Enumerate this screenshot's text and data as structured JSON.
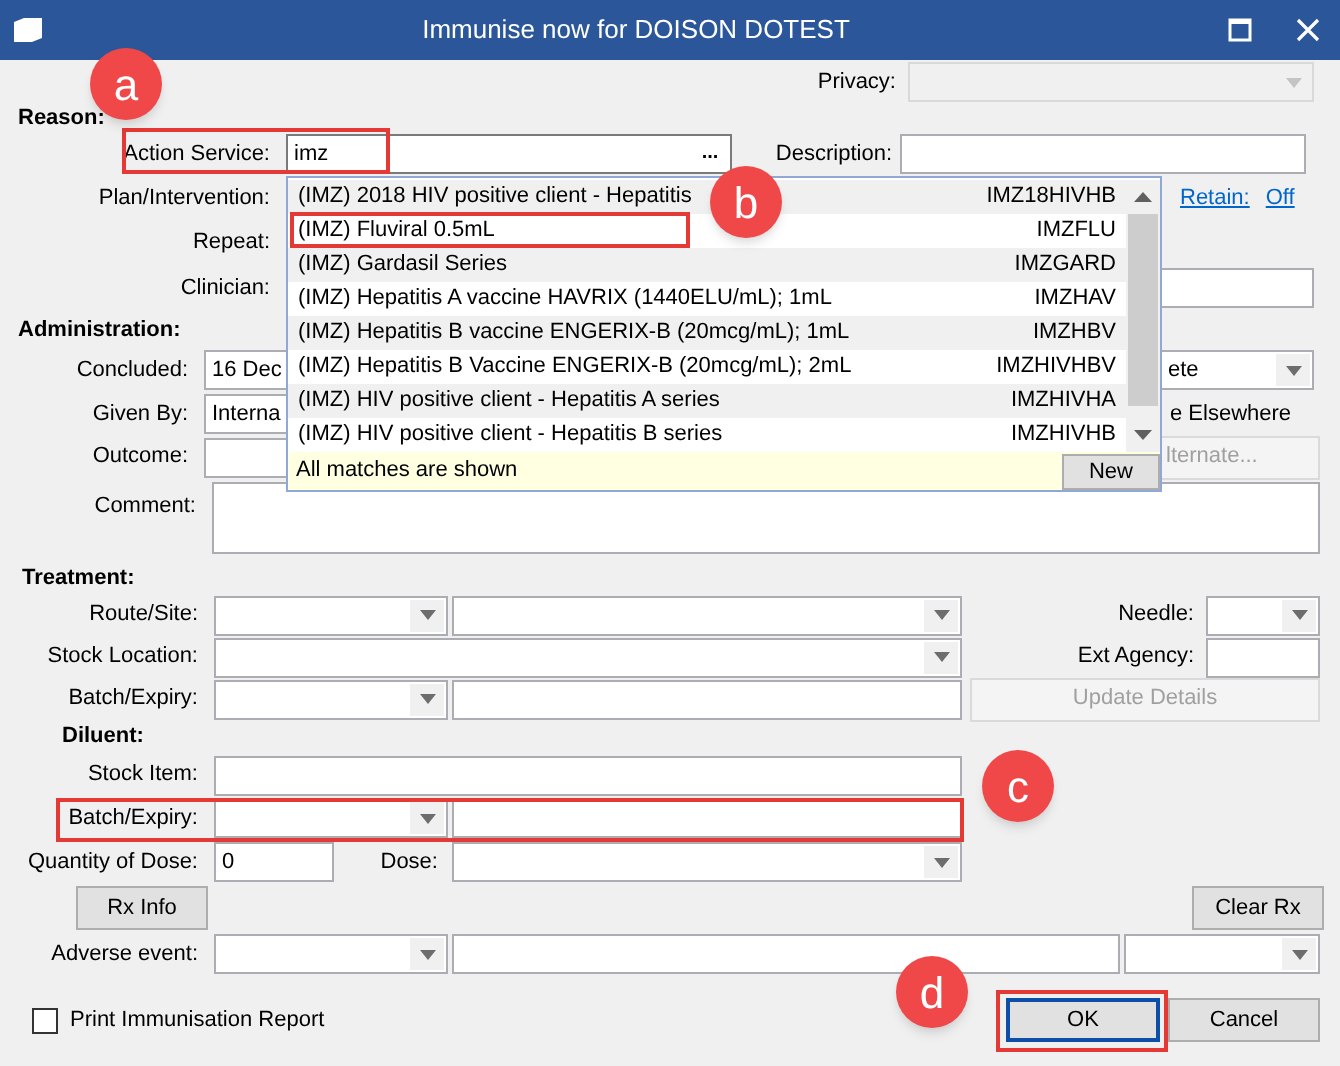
{
  "window": {
    "title": "Immunise now for DOISON DOTEST"
  },
  "privacy": {
    "label": "Privacy:",
    "disabled": true
  },
  "reason": {
    "heading": "Reason:",
    "action_service": {
      "label": "Action Service:",
      "value": "imz",
      "button": "..."
    },
    "description_label": "Description:",
    "plan_label": "Plan/Intervention:",
    "retain": {
      "label": "Retain:",
      "value": "Off"
    },
    "repeat_label": "Repeat:",
    "clinician_label": "Clinician:"
  },
  "administration": {
    "heading": "Administration:",
    "concluded": {
      "label": "Concluded:",
      "value": "16 Dec",
      "right_value": "ete"
    },
    "given_by": {
      "label": "Given By:",
      "value": "Interna",
      "right_text": "e Elsewhere"
    },
    "outcome": {
      "label": "Outcome:",
      "button": "lternate...",
      "button_disabled": true
    },
    "comment_label": "Comment:"
  },
  "treatment": {
    "heading": "Treatment:",
    "route_label": "Route/Site:",
    "needle_label": "Needle:",
    "stock_location_label": "Stock Location:",
    "ext_agency_label": "Ext Agency:",
    "batch_label": "Batch/Expiry:",
    "update_button": {
      "label": "Update Details",
      "disabled": true
    }
  },
  "diluent": {
    "heading": "Diluent:",
    "stock_item_label": "Stock Item:",
    "batch_label": "Batch/Expiry:",
    "quantity": {
      "label": "Quantity of Dose:",
      "value": "0"
    },
    "dose_label": "Dose:"
  },
  "rx_info_button": "Rx Info",
  "clear_rx_button": "Clear Rx",
  "adverse_event_label": "Adverse event:",
  "print_report": {
    "label": "Print Immunisation Report",
    "checked": false
  },
  "ok_button": {
    "label": "OK",
    "focused": true
  },
  "cancel_button": "Cancel",
  "dropdown": {
    "items": [
      {
        "name": "(IMZ) 2018 HIV positive client - Hepatitis",
        "code": "IMZ18HIVHB"
      },
      {
        "name": "(IMZ) Fluviral 0.5mL",
        "code": "IMZFLU"
      },
      {
        "name": "(IMZ) Gardasil Series",
        "code": "IMZGARD"
      },
      {
        "name": "(IMZ) Hepatitis A vaccine HAVRIX (1440ELU/mL); 1mL",
        "code": "IMZHAV"
      },
      {
        "name": "(IMZ) Hepatitis B vaccine ENGERIX-B (20mcg/mL); 1mL",
        "code": "IMZHBV"
      },
      {
        "name": "(IMZ) Hepatitis B Vaccine ENGERIX-B (20mcg/mL); 2mL",
        "code": "IMZHIVHBV"
      },
      {
        "name": "(IMZ) HIV positive client - Hepatitis A series",
        "code": "IMZHIVHA"
      },
      {
        "name": "(IMZ) HIV positive client - Hepatitis B series",
        "code": "IMZHIVHB"
      }
    ],
    "footer": "All matches are shown",
    "new_button": "New"
  },
  "annotations": [
    {
      "letter": "a"
    },
    {
      "letter": "b"
    },
    {
      "letter": "c"
    },
    {
      "letter": "d"
    }
  ]
}
